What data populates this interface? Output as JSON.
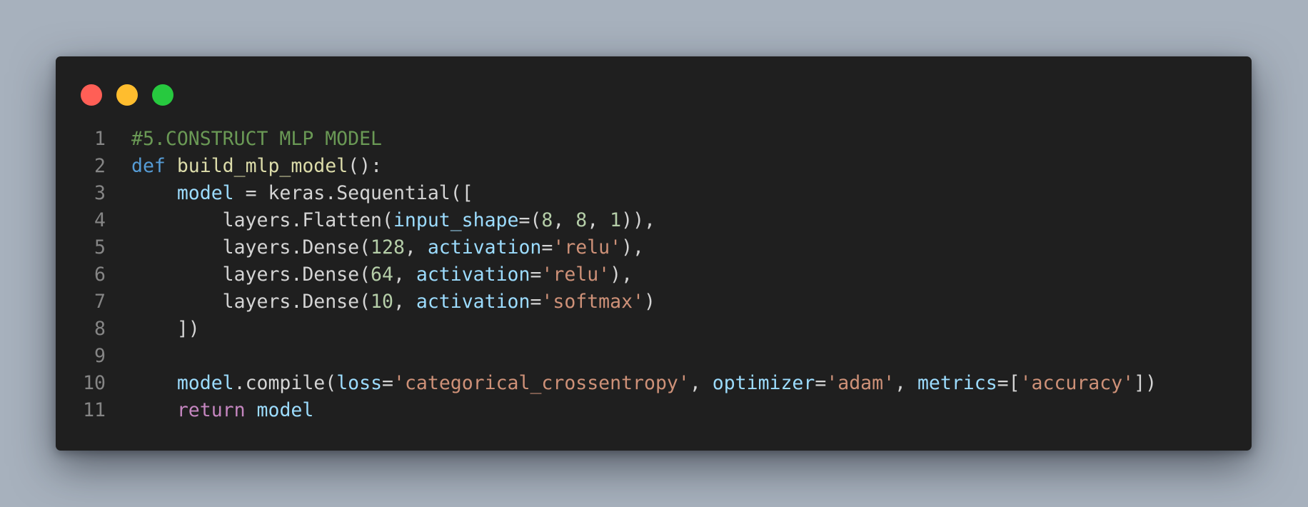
{
  "window": {
    "buttons": [
      {
        "name": "close",
        "color": "#ff5f56"
      },
      {
        "name": "minimize",
        "color": "#ffbd2e"
      },
      {
        "name": "maximize",
        "color": "#27c93f"
      }
    ]
  },
  "colors": {
    "background": "#a7b1bd",
    "editor": "#1f1f1f",
    "comment": "#6a9955",
    "keyword": "#569cd6",
    "control": "#c586c0",
    "function": "#dcdcaa",
    "variable": "#9cdcfe",
    "number": "#b5cea8",
    "string": "#ce9178",
    "plain": "#d4d4d4",
    "line_number": "#858585"
  },
  "code": {
    "lines": [
      {
        "number": "1",
        "tokens": [
          {
            "text": "#5.CONSTRUCT MLP MODEL",
            "type": "comment"
          }
        ]
      },
      {
        "number": "2",
        "tokens": [
          {
            "text": "def",
            "type": "keyword"
          },
          {
            "text": " ",
            "type": "plain"
          },
          {
            "text": "build_mlp_model",
            "type": "function"
          },
          {
            "text": "():",
            "type": "plain"
          }
        ]
      },
      {
        "number": "3",
        "tokens": [
          {
            "text": "    ",
            "type": "plain"
          },
          {
            "text": "model",
            "type": "variable"
          },
          {
            "text": " = keras.Sequential([",
            "type": "plain"
          }
        ]
      },
      {
        "number": "4",
        "tokens": [
          {
            "text": "        layers.Flatten(",
            "type": "plain"
          },
          {
            "text": "input_shape",
            "type": "variable"
          },
          {
            "text": "=(",
            "type": "plain"
          },
          {
            "text": "8",
            "type": "number"
          },
          {
            "text": ", ",
            "type": "plain"
          },
          {
            "text": "8",
            "type": "number"
          },
          {
            "text": ", ",
            "type": "plain"
          },
          {
            "text": "1",
            "type": "number"
          },
          {
            "text": ")),",
            "type": "plain"
          }
        ]
      },
      {
        "number": "5",
        "tokens": [
          {
            "text": "        layers.Dense(",
            "type": "plain"
          },
          {
            "text": "128",
            "type": "number"
          },
          {
            "text": ", ",
            "type": "plain"
          },
          {
            "text": "activation",
            "type": "variable"
          },
          {
            "text": "=",
            "type": "plain"
          },
          {
            "text": "'relu'",
            "type": "string"
          },
          {
            "text": "),",
            "type": "plain"
          }
        ]
      },
      {
        "number": "6",
        "tokens": [
          {
            "text": "        layers.Dense(",
            "type": "plain"
          },
          {
            "text": "64",
            "type": "number"
          },
          {
            "text": ", ",
            "type": "plain"
          },
          {
            "text": "activation",
            "type": "variable"
          },
          {
            "text": "=",
            "type": "plain"
          },
          {
            "text": "'relu'",
            "type": "string"
          },
          {
            "text": "),",
            "type": "plain"
          }
        ]
      },
      {
        "number": "7",
        "tokens": [
          {
            "text": "        layers.Dense(",
            "type": "plain"
          },
          {
            "text": "10",
            "type": "number"
          },
          {
            "text": ", ",
            "type": "plain"
          },
          {
            "text": "activation",
            "type": "variable"
          },
          {
            "text": "=",
            "type": "plain"
          },
          {
            "text": "'softmax'",
            "type": "string"
          },
          {
            "text": ")",
            "type": "plain"
          }
        ]
      },
      {
        "number": "8",
        "tokens": [
          {
            "text": "    ])",
            "type": "plain"
          }
        ]
      },
      {
        "number": "9",
        "tokens": []
      },
      {
        "number": "10",
        "tokens": [
          {
            "text": "    ",
            "type": "plain"
          },
          {
            "text": "model",
            "type": "variable"
          },
          {
            "text": ".compile(",
            "type": "plain"
          },
          {
            "text": "loss",
            "type": "variable"
          },
          {
            "text": "=",
            "type": "plain"
          },
          {
            "text": "'categorical_crossentropy'",
            "type": "string"
          },
          {
            "text": ", ",
            "type": "plain"
          },
          {
            "text": "optimizer",
            "type": "variable"
          },
          {
            "text": "=",
            "type": "plain"
          },
          {
            "text": "'adam'",
            "type": "string"
          },
          {
            "text": ", ",
            "type": "plain"
          },
          {
            "text": "metrics",
            "type": "variable"
          },
          {
            "text": "=[",
            "type": "plain"
          },
          {
            "text": "'accuracy'",
            "type": "string"
          },
          {
            "text": "])",
            "type": "plain"
          }
        ]
      },
      {
        "number": "11",
        "tokens": [
          {
            "text": "    ",
            "type": "plain"
          },
          {
            "text": "return",
            "type": "control"
          },
          {
            "text": " ",
            "type": "plain"
          },
          {
            "text": "model",
            "type": "variable"
          }
        ]
      }
    ]
  }
}
